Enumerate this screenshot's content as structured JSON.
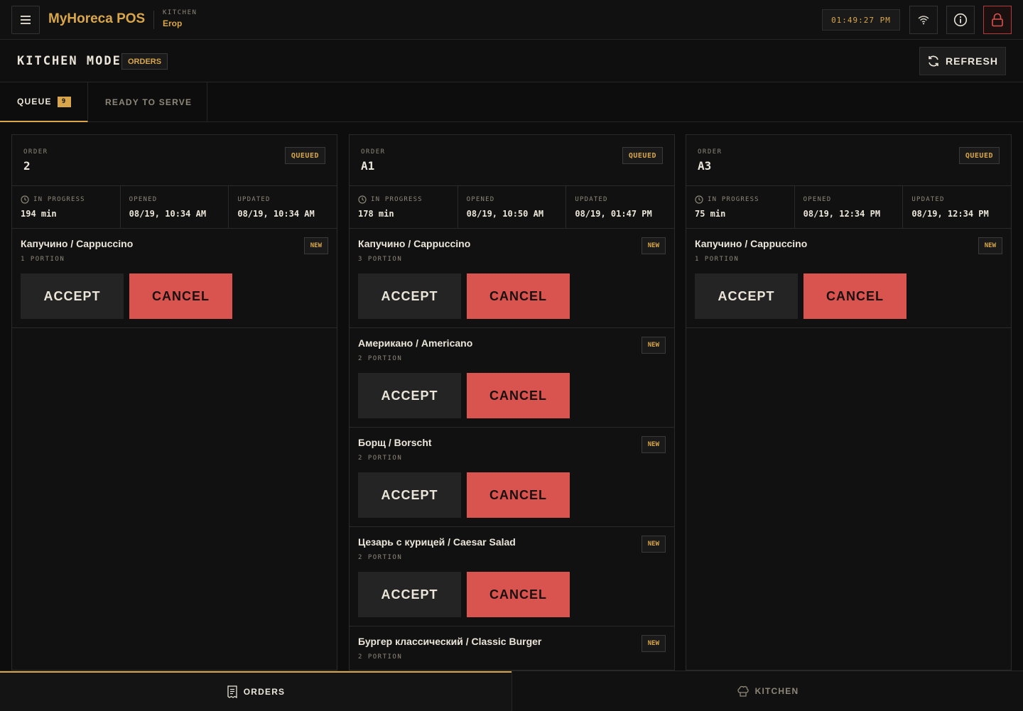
{
  "topbar": {
    "brand": "MyHoreca POS",
    "context_label": "KITCHEN",
    "context_value": "Erop",
    "clock": "01:49:27 PM"
  },
  "header": {
    "title": "KITCHEN MODE",
    "badge": "ORDERS",
    "refresh_label": "REFRESH"
  },
  "tabs": {
    "queue_label": "QUEUE",
    "queue_count": "9",
    "ready_label": "READY TO SERVE"
  },
  "labels": {
    "order": "ORDER",
    "in_progress": "IN PROGRESS",
    "opened": "OPENED",
    "updated": "UPDATED",
    "accept": "ACCEPT",
    "cancel": "CANCEL",
    "new": "NEW"
  },
  "orders": [
    {
      "number": "2",
      "status": "QUEUED",
      "in_progress": "194 min",
      "opened": "08/19, 10:34 AM",
      "updated": "08/19, 10:34 AM",
      "items": [
        {
          "name": "Капучино / Cappuccino",
          "qty": "1 PORTION",
          "status": "NEW"
        }
      ]
    },
    {
      "number": "A1",
      "status": "QUEUED",
      "in_progress": "178 min",
      "opened": "08/19, 10:50 AM",
      "updated": "08/19, 01:47 PM",
      "items": [
        {
          "name": "Капучино / Cappuccino",
          "qty": "3 PORTION",
          "status": "NEW"
        },
        {
          "name": "Американо / Americano",
          "qty": "2 PORTION",
          "status": "NEW"
        },
        {
          "name": "Борщ / Borscht",
          "qty": "2 PORTION",
          "status": "NEW"
        },
        {
          "name": "Цезарь с курицей / Caesar Salad",
          "qty": "2 PORTION",
          "status": "NEW"
        },
        {
          "name": "Бургер классический / Classic Burger",
          "qty": "2 PORTION",
          "status": "NEW"
        }
      ]
    },
    {
      "number": "A3",
      "status": "QUEUED",
      "in_progress": "75 min",
      "opened": "08/19, 12:34 PM",
      "updated": "08/19, 12:34 PM",
      "items": [
        {
          "name": "Капучино / Cappuccino",
          "qty": "1 PORTION",
          "status": "NEW"
        }
      ]
    }
  ],
  "bottom_nav": {
    "orders_label": "ORDERS",
    "kitchen_label": "KITCHEN"
  },
  "colors": {
    "accent": "#d9a74a",
    "danger": "#d9534f",
    "background": "#0d0d0d"
  }
}
